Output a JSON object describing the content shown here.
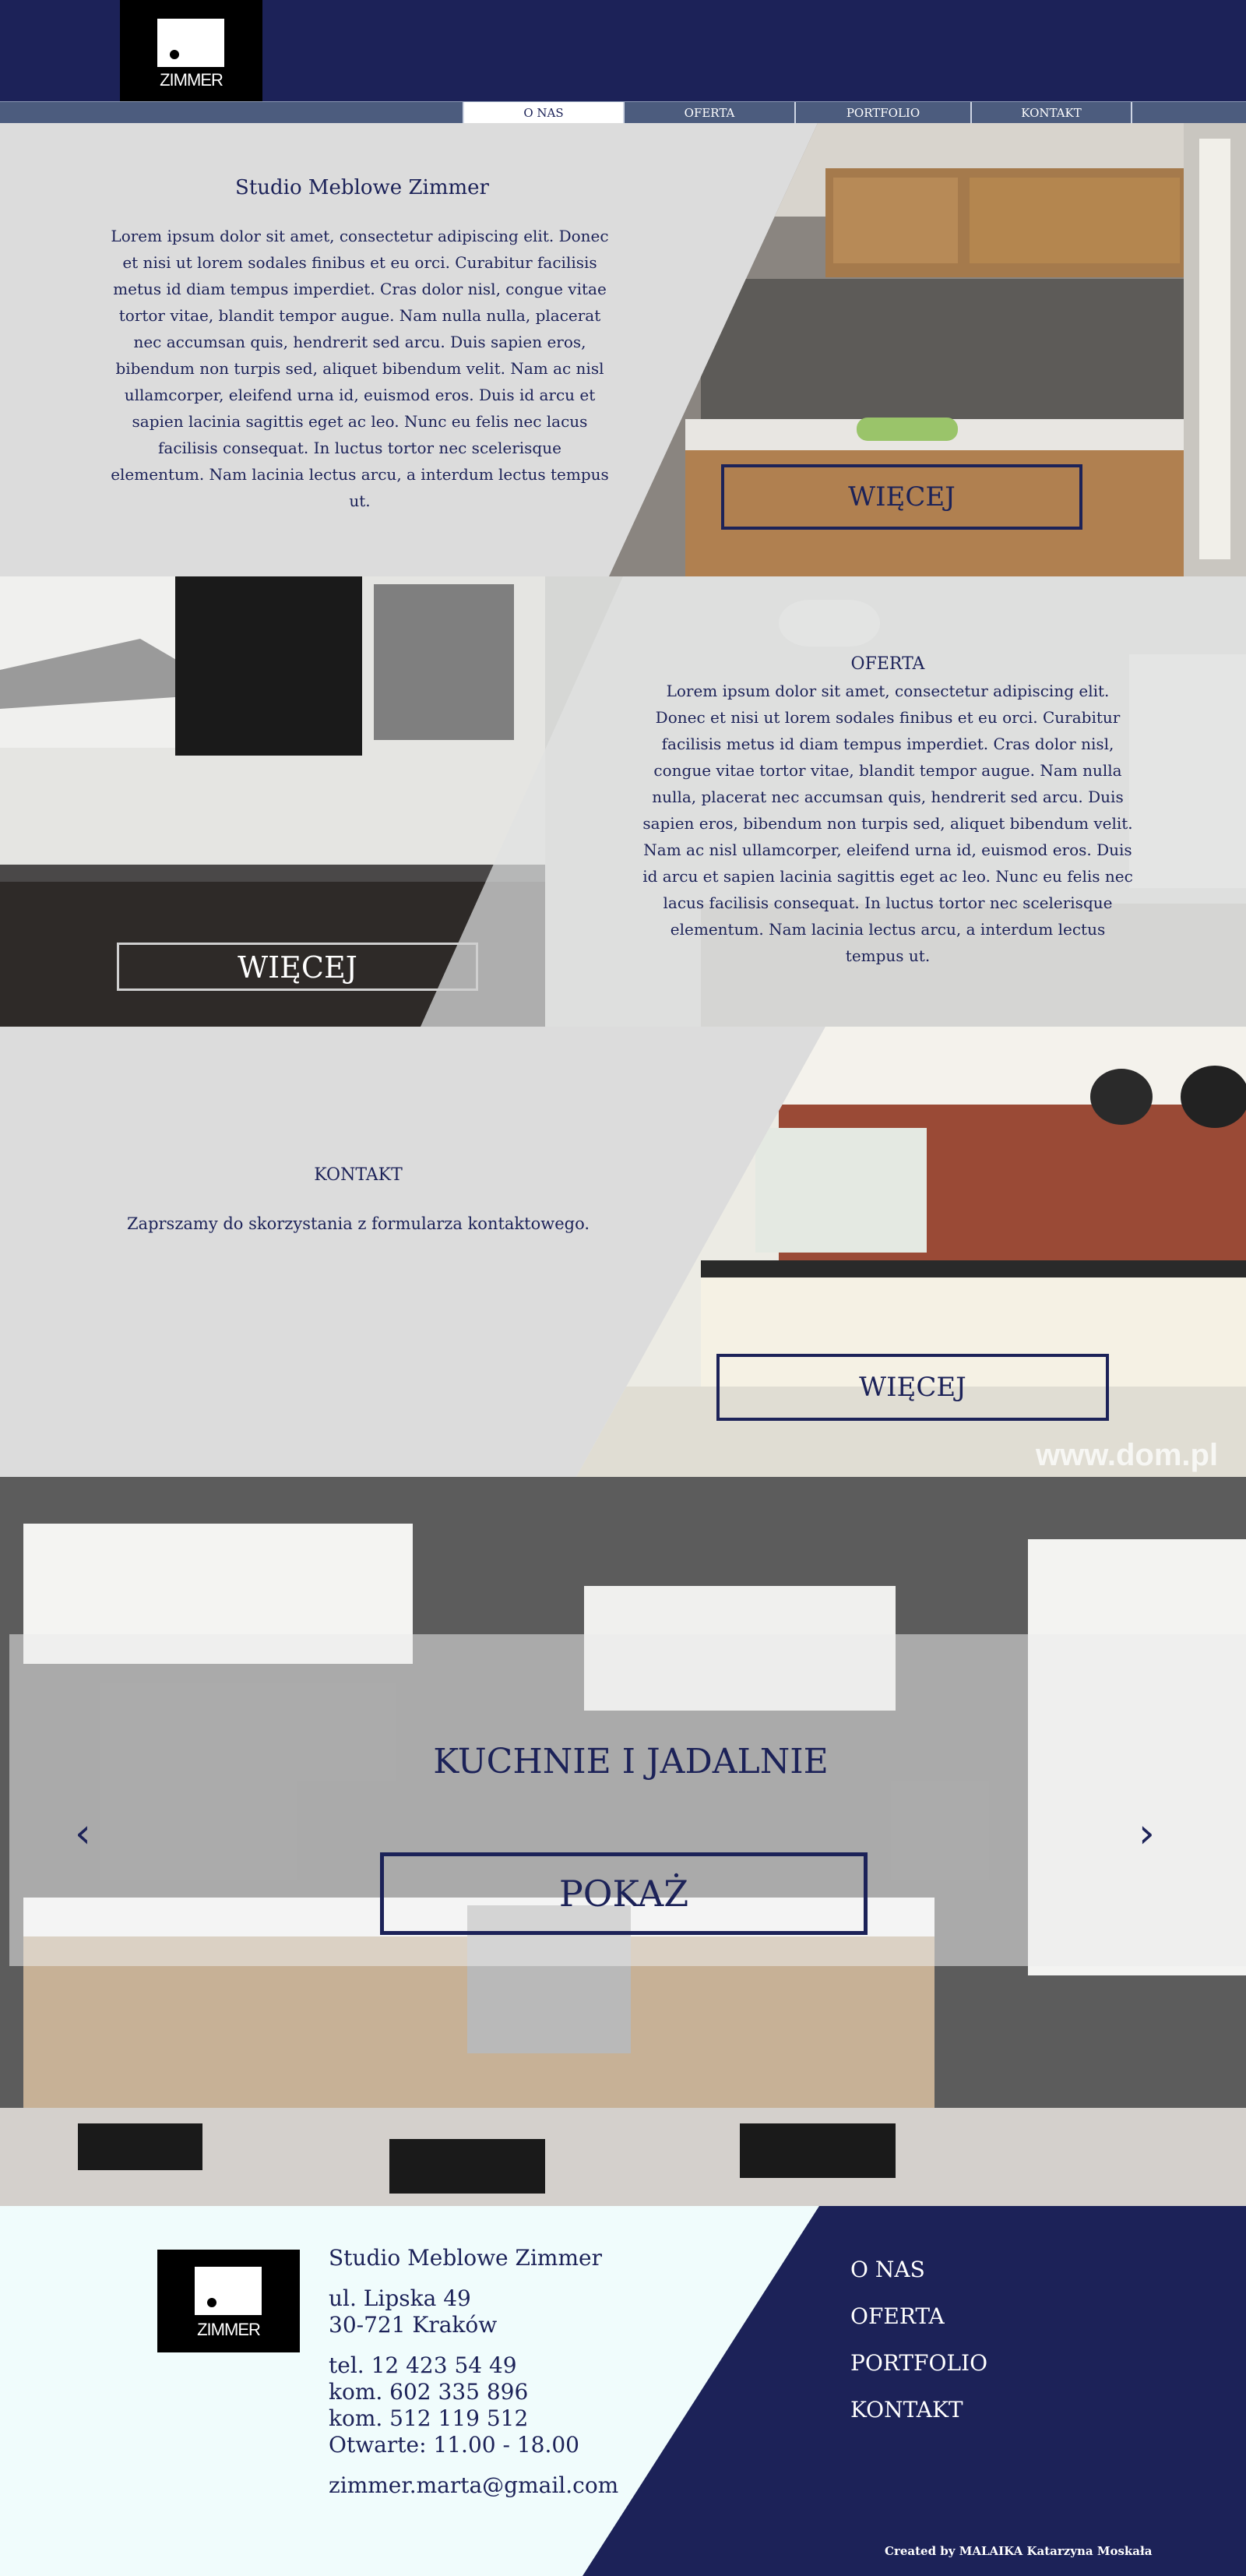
{
  "header": {
    "logo_text": "ZIMMER",
    "nav": [
      "O NAS",
      "OFERTA",
      "PORTFOLIO",
      "KONTAKT"
    ],
    "active_nav": "O NAS"
  },
  "about": {
    "title": "Studio Meblowe Zimmer",
    "text": "Lorem ipsum dolor sit amet, consectetur adipiscing elit. Donec et nisi ut lorem sodales finibus et eu orci. Curabitur facilisis metus id diam tempus imperdiet. Cras dolor nisl, congue vitae tortor vitae, blandit tempor augue. Nam nulla nulla, placerat nec accumsan quis, hendrerit sed arcu. Duis sapien eros, bibendum non turpis sed, aliquet bibendum velit. Nam ac nisl ullamcorper, eleifend urna id, euismod eros. Duis id arcu et sapien lacinia sagittis eget ac leo. Nunc eu felis nec lacus facilisis consequat. In luctus tortor nec scelerisque elementum. Nam lacinia lectus arcu, a interdum lectus tempus ut.",
    "button": "WIĘCEJ"
  },
  "offer": {
    "title": "OFERTA",
    "text": "Lorem ipsum dolor sit amet, consectetur adipiscing elit. Donec et nisi ut lorem sodales finibus et eu orci. Curabitur facilisis metus id diam tempus imperdiet. Cras dolor nisl, congue vitae tortor vitae, blandit tempor augue. Nam nulla nulla, placerat nec accumsan quis, hendrerit sed arcu. Duis sapien eros, bibendum non turpis sed, aliquet bibendum velit. Nam ac nisl ullamcorper, eleifend urna id, euismod eros. Duis id arcu et sapien lacinia sagittis eget ac leo. Nunc eu felis nec lacus facilisis consequat. In luctus tortor nec scelerisque elementum. Nam lacinia lectus arcu, a interdum lectus tempus ut.",
    "button": "WIĘCEJ"
  },
  "contact": {
    "title": "KONTAKT",
    "text": "Zaprszamy do skorzystania z formularza kontaktowego.",
    "button": "WIĘCEJ",
    "watermark": "www.dom.pl"
  },
  "slider": {
    "title": "KUCHNIE I JADALNIE",
    "button": "POKAŻ",
    "prev_glyph": "‹",
    "next_glyph": "›"
  },
  "footer": {
    "logo_text": "ZIMMER",
    "company": "Studio Meblowe Zimmer",
    "street": "ul. Lipska 49",
    "city": "30-721 Kraków",
    "phone": "tel. 12 423 54 49",
    "mobile1": "kom. 602 335 896",
    "mobile2": "kom. 512 119 512",
    "hours": "Otwarte: 11.00 - 18.00",
    "email": "zimmer.marta@gmail.com",
    "nav": [
      "O NAS",
      "OFERTA",
      "PORTFOLIO",
      "KONTAKT"
    ],
    "credit": "Created by MALAIKA Katarzyna Moskała"
  },
  "colors": {
    "brand_navy": "#1c2258",
    "panel_gray": "#dcdcdc",
    "footer_bg": "#f0fcfc"
  }
}
